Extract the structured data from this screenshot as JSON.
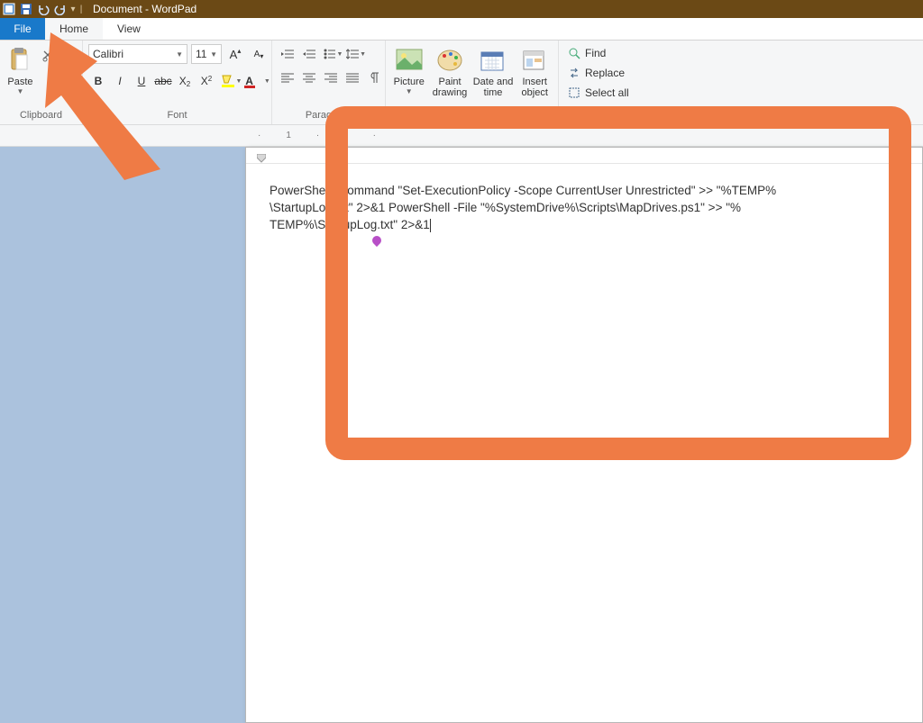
{
  "titlebar": {
    "title": "Document - WordPad",
    "qat_icons": [
      "app-icon",
      "save-icon",
      "undo-icon",
      "redo-icon"
    ]
  },
  "tabs": {
    "file": "File",
    "home": "Home",
    "view": "View"
  },
  "ribbon": {
    "clipboard": {
      "label": "Clipboard",
      "paste": "Paste",
      "cut": "Cut"
    },
    "font": {
      "label": "Font",
      "name": "Calibri",
      "size": "11"
    },
    "paragraph": {
      "label": "Paragraph"
    },
    "insert": {
      "picture": "Picture",
      "paint": "Paint drawing",
      "date": "Date and time",
      "object": "Insert object"
    },
    "editing": {
      "find": "Find",
      "replace": "Replace",
      "selectall": "Select all"
    }
  },
  "ruler": {
    "left_mark": "1"
  },
  "document": {
    "line1": "PowerShell -Command \"Set-ExecutionPolicy -Scope CurrentUser Unrestricted\" >> \"%TEMP%",
    "line2": "\\StartupLog.txt\" 2>&1 PowerShell -File \"%SystemDrive%\\Scripts\\MapDrives.ps1\" >> \"%",
    "line3": "TEMP%\\StartupLog.txt\" 2>&1"
  }
}
